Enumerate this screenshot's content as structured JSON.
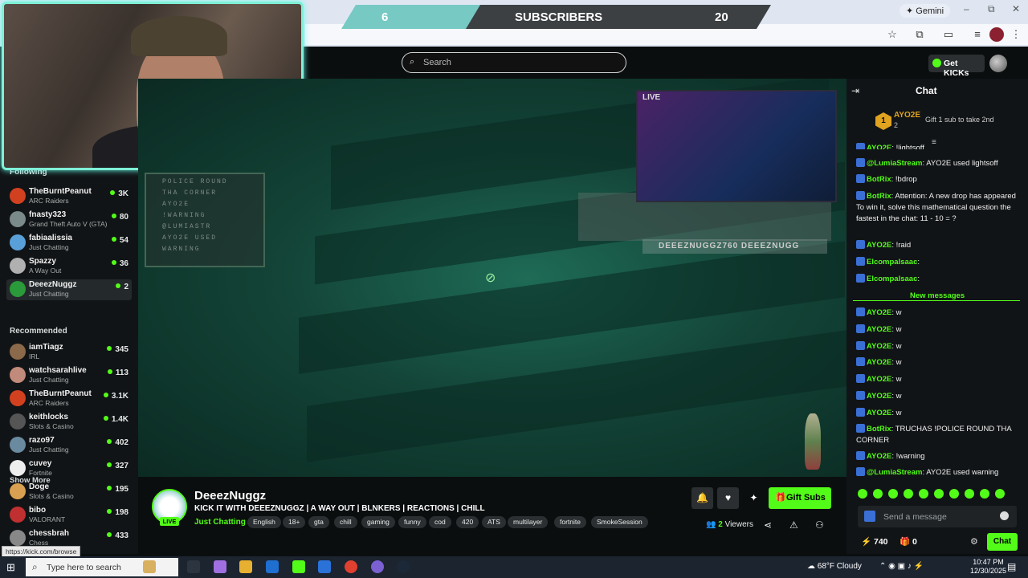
{
  "overlay": {
    "left_count": "6",
    "label": "SUBSCRIBERS",
    "right_count": "20"
  },
  "browser": {
    "gemini_label": "Gemini",
    "url_hint": "https://kick.com/browse"
  },
  "header": {
    "search_placeholder": "Search",
    "get_kicks_label": "Get KICKs"
  },
  "sidebar": {
    "following_label": "Following",
    "following": [
      {
        "name": "TheBurntPeanut",
        "game": "ARC Raiders",
        "viewers": "3K",
        "color": "#d2411f"
      },
      {
        "name": "fnasty323",
        "game": "Grand Theft Auto V (GTA)",
        "viewers": "80",
        "color": "#7a8a8a"
      },
      {
        "name": "fabiaalissia",
        "game": "Just Chatting",
        "viewers": "54",
        "color": "#5aa0d8"
      },
      {
        "name": "Spazzy",
        "game": "A Way Out",
        "viewers": "36",
        "color": "#b0b0b0"
      },
      {
        "name": "DeeezNuggz",
        "game": "Just Chatting",
        "viewers": "2",
        "color": "#2a9a3a"
      }
    ],
    "show_more_label": "Show More",
    "recommended_label": "Recommended",
    "recommended": [
      {
        "name": "iamTiagz",
        "game": "IRL",
        "viewers": "345",
        "color": "#8a6a4a"
      },
      {
        "name": "watchsarahlive",
        "game": "Just Chatting",
        "viewers": "113",
        "color": "#c28a7a"
      },
      {
        "name": "TheBurntPeanut",
        "game": "ARC Raiders",
        "viewers": "3.1K",
        "color": "#d2411f"
      },
      {
        "name": "keithlocks",
        "game": "Slots & Casino",
        "viewers": "1.4K",
        "color": "#555"
      },
      {
        "name": "razo97",
        "game": "Just Chatting",
        "viewers": "402",
        "color": "#6a8aa0"
      },
      {
        "name": "cuvey",
        "game": "Fortnite",
        "viewers": "327",
        "color": "#eee"
      },
      {
        "name": "Doge",
        "game": "Slots & Casino",
        "viewers": "195",
        "color": "#d8a050"
      },
      {
        "name": "bibo",
        "game": "VALORANT",
        "viewers": "198",
        "color": "#c03030"
      },
      {
        "name": "chessbrah",
        "game": "Chess",
        "viewers": "433",
        "color": "#888"
      }
    ]
  },
  "stream": {
    "name": "DeeezNuggz",
    "live_label": "LIVE",
    "title": "KICK IT WITH DEEEZNUGGZ | A WAY OUT | BLNKERS | REACTIONS | CHILL",
    "category": "Just Chatting",
    "tags": [
      "English",
      "18+",
      "gta",
      "chill",
      "gaming",
      "funny",
      "cod",
      "420",
      "ATS",
      "multilayer",
      "fortnite",
      "SmokeSession"
    ],
    "viewers_count": "2",
    "viewers_label": "Viewers",
    "gift_subs_label": "Gift Subs",
    "pip_live": "LIVE",
    "overlay_lines": [
      "POLICE ROUND",
      "THA CORNER",
      "AYO2E",
      "!WARNING",
      "@LUMIASTR",
      "AYO2E USED",
      "WARNING"
    ],
    "social_handles": "DEEEZNUGGZ760 DEEEZNUGG"
  },
  "chat": {
    "title": "Chat",
    "pinned": {
      "rank": "1",
      "name": "AYO2E",
      "count": "2",
      "text": "Gift 1 sub to take 2nd"
    },
    "messages": [
      {
        "user": "AYO2E",
        "text": "!lightsoff",
        "color": "#53fc18"
      },
      {
        "user": "@LumiaStream",
        "text": "AYO2E used lightsoff",
        "color": "#53fc18"
      },
      {
        "user": "BotRix",
        "text": "!bdrop",
        "color": "#53fc18"
      },
      {
        "user": "BotRix",
        "text": "Attention: A new drop has appeared To win it, solve this mathematical question the fastest in the chat: 11 - 10 = ?",
        "color": "#53fc18"
      },
      {
        "user": "AYO2E",
        "text": "!raid",
        "color": "#53fc18"
      },
      {
        "user": "Elcompalsaac",
        "text": "",
        "color": "#53fc18"
      },
      {
        "user": "Elcompalsaac",
        "text": "",
        "color": "#53fc18"
      }
    ],
    "new_messages_label": "New messages",
    "new_messages": [
      {
        "user": "AYO2E",
        "text": "w"
      },
      {
        "user": "AYO2E",
        "text": "w"
      },
      {
        "user": "AYO2E",
        "text": "w"
      },
      {
        "user": "AYO2E",
        "text": "w"
      },
      {
        "user": "AYO2E",
        "text": "w"
      },
      {
        "user": "AYO2E",
        "text": "w"
      },
      {
        "user": "AYO2E",
        "text": "w"
      },
      {
        "user": "BotRix",
        "text": "TRUCHAS !POLICE ROUND THA CORNER"
      },
      {
        "user": "AYO2E",
        "text": "!warning"
      },
      {
        "user": "@LumiaStream",
        "text": "AYO2E used warning"
      }
    ],
    "input_placeholder": "Send a message",
    "kicks_points": "740",
    "gift_count": "0",
    "send_label": "Chat"
  },
  "taskbar": {
    "search_placeholder": "Type here to search",
    "weather": "68°F  Cloudy",
    "time": "10:47 PM",
    "date": "12/30/2025"
  }
}
